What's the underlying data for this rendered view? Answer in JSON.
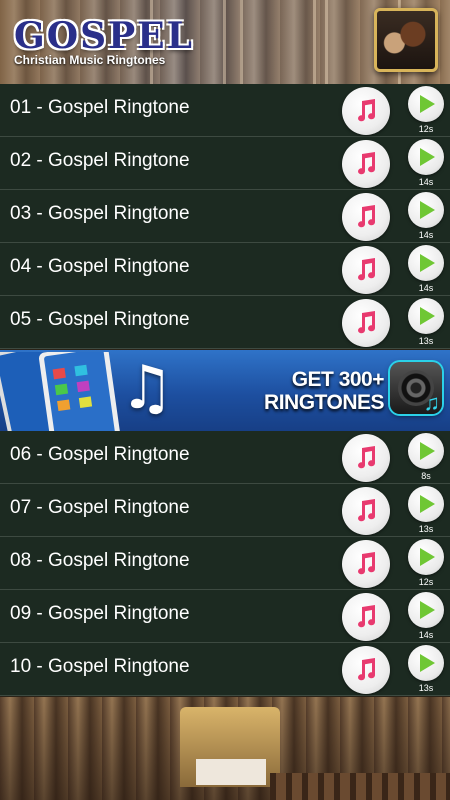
{
  "header": {
    "app_title": "GOSPEL",
    "app_subtitle": "Christian Music Ringtones"
  },
  "colors": {
    "row_background": "#1c2a21",
    "play_green": "#6fc734",
    "ringtone_pink": "#e83a6f",
    "banner_blue": "#1d4fa0"
  },
  "ringtones": [
    {
      "title": "01 - Gospel Ringtone",
      "duration": "12s"
    },
    {
      "title": "02 - Gospel Ringtone",
      "duration": "14s"
    },
    {
      "title": "03 - Gospel Ringtone",
      "duration": "14s"
    },
    {
      "title": "04 - Gospel Ringtone",
      "duration": "14s"
    },
    {
      "title": "05 - Gospel Ringtone",
      "duration": "13s"
    },
    {
      "title": "06 - Gospel Ringtone",
      "duration": "8s"
    },
    {
      "title": "07 - Gospel Ringtone",
      "duration": "13s"
    },
    {
      "title": "08 - Gospel Ringtone",
      "duration": "12s"
    },
    {
      "title": "09 - Gospel Ringtone",
      "duration": "14s"
    },
    {
      "title": "10 - Gospel Ringtone",
      "duration": "13s"
    }
  ],
  "banner": {
    "line1": "GET 300+",
    "line2": "RINGTONES",
    "icon": "speaker-music-icon"
  },
  "icons": {
    "set_ringtone": "music-note-icon",
    "play": "play-icon"
  }
}
